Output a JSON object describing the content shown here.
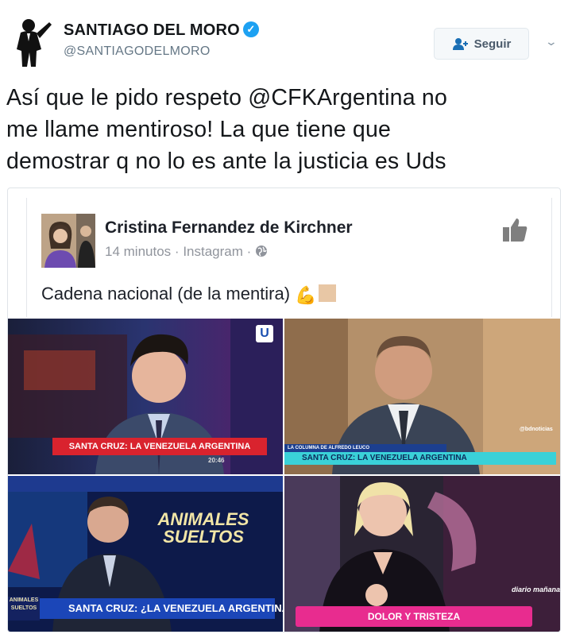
{
  "author": {
    "name": "SANTIAGO DEL MORO",
    "handle": "@SANTIAGODELMORO",
    "verified_icon": "verified-check-icon"
  },
  "follow_button": {
    "label": "Seguir",
    "icon": "add-user-icon"
  },
  "menu": {
    "icon": "chevron-down-icon"
  },
  "tweet": {
    "lines": [
      "Así que le pido respeto @CFKArgentina no",
      "me llame mentiroso! La que tiene que",
      "demostrar q no lo es ante la justicia es Uds"
    ]
  },
  "fb_post": {
    "author": "Cristina Fernandez de Kirchner",
    "time": "14 minutos",
    "sep1": "·",
    "source": "Instagram",
    "sep2": "·",
    "privacy_icon": "globe-icon",
    "like_icon": "thumbs-up-icon",
    "text": "Cadena nacional (de la mentira)",
    "emoji": "flexed-biceps-emoji"
  },
  "panels": {
    "top_left": {
      "caption": "SANTA CRUZ: LA VENEZUELA ARGENTINA",
      "channel_logo": "U",
      "clock": "20:46"
    },
    "top_right": {
      "small_label": "LA COLUMNA DE ALFREDO LEUCO",
      "caption": "SANTA CRUZ: LA VENEZUELA ARGENTINA",
      "badge": "@bdnoticias"
    },
    "bottom_left": {
      "show_logo_line1": "ANIMALES",
      "show_logo_line2": "SUELTOS",
      "caption": "SANTA CRUZ: ¿LA VENEZUELA ARGENTINA?",
      "mini_logo": "ANIMALES SUELTOS"
    },
    "bottom_right": {
      "caption": "DOLOR Y TRISTEZA",
      "show_logo": "diario mañana"
    }
  },
  "colors": {
    "verified": "#1da1f2",
    "text_primary": "#14171a",
    "text_secondary": "#657786",
    "caption_red": "#d9232e",
    "caption_cyan": "#3ad1d8",
    "caption_blue": "#1c3f8f",
    "caption_pink": "#e82c8f"
  }
}
